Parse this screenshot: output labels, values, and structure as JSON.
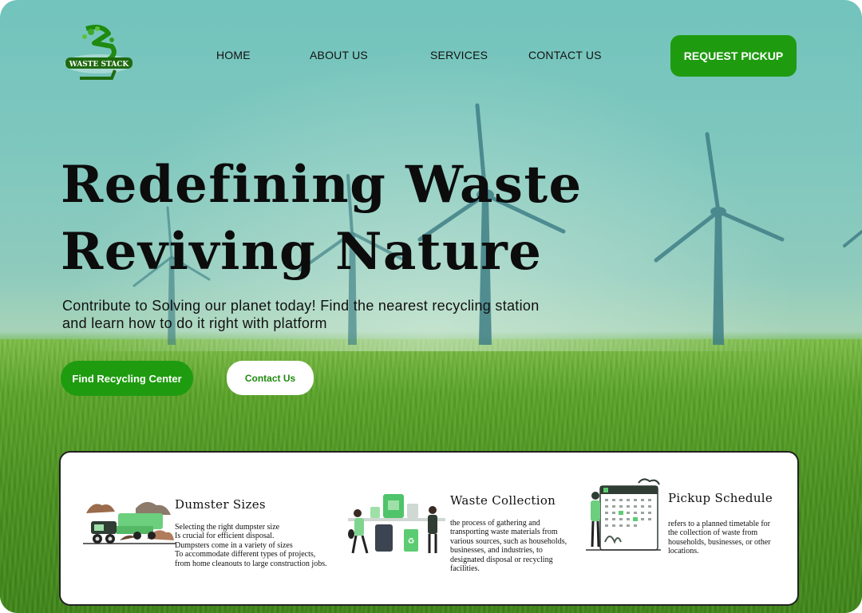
{
  "logo": {
    "text": "WASTE STACK"
  },
  "nav": {
    "home": "HOME",
    "about": "ABOUT US",
    "services": "SERVICES",
    "contact": "CONTACT US",
    "request_pickup": "REQUEST PICKUP"
  },
  "hero": {
    "title_line1": "Redefining Waste",
    "title_line2": "Reviving Nature",
    "subtitle_line1": "Contribute to Solving our planet today! Find the nearest recycling station",
    "subtitle_line2": "and learn how to do it right with platform",
    "primary_button": "Find Recycling Center",
    "secondary_button": "Contact Us"
  },
  "cards": [
    {
      "title": "Dumster Sizes",
      "icon": "dumpster-truck-illustration",
      "lines": [
        "Selecting the right dumpster size",
        "Is crucial for efficient disposal.",
        "Dumpsters come in a variety of sizes",
        "To accommodate different types of projects,",
        "from home cleanouts to large construction jobs."
      ]
    },
    {
      "title": "Waste Collection",
      "icon": "waste-collection-illustration",
      "lines": [
        "the process of gathering and",
        "transporting waste materials from",
        "various sources, such as households,",
        "businesses, and industries, to",
        "designated disposal or recycling",
        "facilities."
      ]
    },
    {
      "title": "Pickup Schedule",
      "icon": "calendar-schedule-illustration",
      "lines": [
        "refers to a planned timetable for",
        "the collection of waste from",
        "households, businesses, or other",
        "locations."
      ]
    }
  ],
  "colors": {
    "accent": "#1f9b10",
    "dark": "#111111",
    "card_bg": "#ffffff"
  }
}
